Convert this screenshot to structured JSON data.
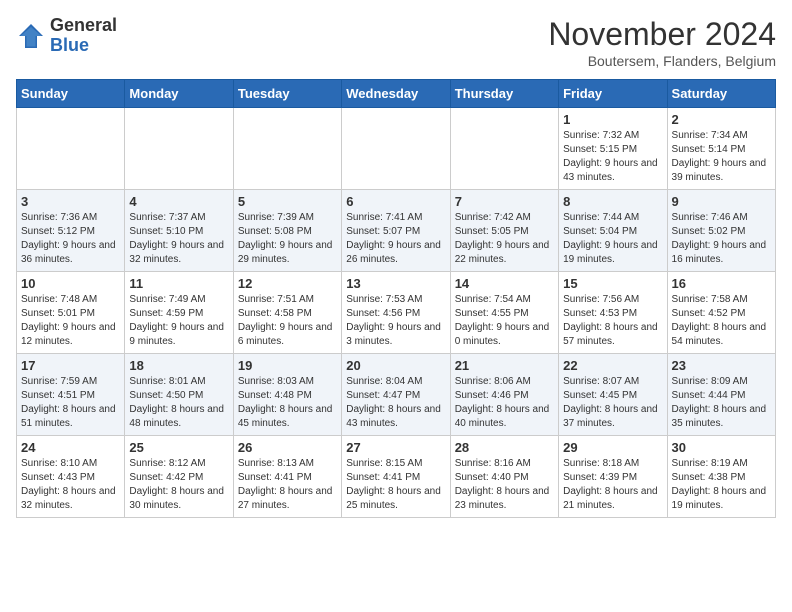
{
  "logo": {
    "general": "General",
    "blue": "Blue"
  },
  "header": {
    "month": "November 2024",
    "location": "Boutersem, Flanders, Belgium"
  },
  "weekdays": [
    "Sunday",
    "Monday",
    "Tuesday",
    "Wednesday",
    "Thursday",
    "Friday",
    "Saturday"
  ],
  "weeks": [
    [
      {
        "day": "",
        "info": ""
      },
      {
        "day": "",
        "info": ""
      },
      {
        "day": "",
        "info": ""
      },
      {
        "day": "",
        "info": ""
      },
      {
        "day": "",
        "info": ""
      },
      {
        "day": "1",
        "info": "Sunrise: 7:32 AM\nSunset: 5:15 PM\nDaylight: 9 hours and 43 minutes."
      },
      {
        "day": "2",
        "info": "Sunrise: 7:34 AM\nSunset: 5:14 PM\nDaylight: 9 hours and 39 minutes."
      }
    ],
    [
      {
        "day": "3",
        "info": "Sunrise: 7:36 AM\nSunset: 5:12 PM\nDaylight: 9 hours and 36 minutes."
      },
      {
        "day": "4",
        "info": "Sunrise: 7:37 AM\nSunset: 5:10 PM\nDaylight: 9 hours and 32 minutes."
      },
      {
        "day": "5",
        "info": "Sunrise: 7:39 AM\nSunset: 5:08 PM\nDaylight: 9 hours and 29 minutes."
      },
      {
        "day": "6",
        "info": "Sunrise: 7:41 AM\nSunset: 5:07 PM\nDaylight: 9 hours and 26 minutes."
      },
      {
        "day": "7",
        "info": "Sunrise: 7:42 AM\nSunset: 5:05 PM\nDaylight: 9 hours and 22 minutes."
      },
      {
        "day": "8",
        "info": "Sunrise: 7:44 AM\nSunset: 5:04 PM\nDaylight: 9 hours and 19 minutes."
      },
      {
        "day": "9",
        "info": "Sunrise: 7:46 AM\nSunset: 5:02 PM\nDaylight: 9 hours and 16 minutes."
      }
    ],
    [
      {
        "day": "10",
        "info": "Sunrise: 7:48 AM\nSunset: 5:01 PM\nDaylight: 9 hours and 12 minutes."
      },
      {
        "day": "11",
        "info": "Sunrise: 7:49 AM\nSunset: 4:59 PM\nDaylight: 9 hours and 9 minutes."
      },
      {
        "day": "12",
        "info": "Sunrise: 7:51 AM\nSunset: 4:58 PM\nDaylight: 9 hours and 6 minutes."
      },
      {
        "day": "13",
        "info": "Sunrise: 7:53 AM\nSunset: 4:56 PM\nDaylight: 9 hours and 3 minutes."
      },
      {
        "day": "14",
        "info": "Sunrise: 7:54 AM\nSunset: 4:55 PM\nDaylight: 9 hours and 0 minutes."
      },
      {
        "day": "15",
        "info": "Sunrise: 7:56 AM\nSunset: 4:53 PM\nDaylight: 8 hours and 57 minutes."
      },
      {
        "day": "16",
        "info": "Sunrise: 7:58 AM\nSunset: 4:52 PM\nDaylight: 8 hours and 54 minutes."
      }
    ],
    [
      {
        "day": "17",
        "info": "Sunrise: 7:59 AM\nSunset: 4:51 PM\nDaylight: 8 hours and 51 minutes."
      },
      {
        "day": "18",
        "info": "Sunrise: 8:01 AM\nSunset: 4:50 PM\nDaylight: 8 hours and 48 minutes."
      },
      {
        "day": "19",
        "info": "Sunrise: 8:03 AM\nSunset: 4:48 PM\nDaylight: 8 hours and 45 minutes."
      },
      {
        "day": "20",
        "info": "Sunrise: 8:04 AM\nSunset: 4:47 PM\nDaylight: 8 hours and 43 minutes."
      },
      {
        "day": "21",
        "info": "Sunrise: 8:06 AM\nSunset: 4:46 PM\nDaylight: 8 hours and 40 minutes."
      },
      {
        "day": "22",
        "info": "Sunrise: 8:07 AM\nSunset: 4:45 PM\nDaylight: 8 hours and 37 minutes."
      },
      {
        "day": "23",
        "info": "Sunrise: 8:09 AM\nSunset: 4:44 PM\nDaylight: 8 hours and 35 minutes."
      }
    ],
    [
      {
        "day": "24",
        "info": "Sunrise: 8:10 AM\nSunset: 4:43 PM\nDaylight: 8 hours and 32 minutes."
      },
      {
        "day": "25",
        "info": "Sunrise: 8:12 AM\nSunset: 4:42 PM\nDaylight: 8 hours and 30 minutes."
      },
      {
        "day": "26",
        "info": "Sunrise: 8:13 AM\nSunset: 4:41 PM\nDaylight: 8 hours and 27 minutes."
      },
      {
        "day": "27",
        "info": "Sunrise: 8:15 AM\nSunset: 4:41 PM\nDaylight: 8 hours and 25 minutes."
      },
      {
        "day": "28",
        "info": "Sunrise: 8:16 AM\nSunset: 4:40 PM\nDaylight: 8 hours and 23 minutes."
      },
      {
        "day": "29",
        "info": "Sunrise: 8:18 AM\nSunset: 4:39 PM\nDaylight: 8 hours and 21 minutes."
      },
      {
        "day": "30",
        "info": "Sunrise: 8:19 AM\nSunset: 4:38 PM\nDaylight: 8 hours and 19 minutes."
      }
    ]
  ]
}
